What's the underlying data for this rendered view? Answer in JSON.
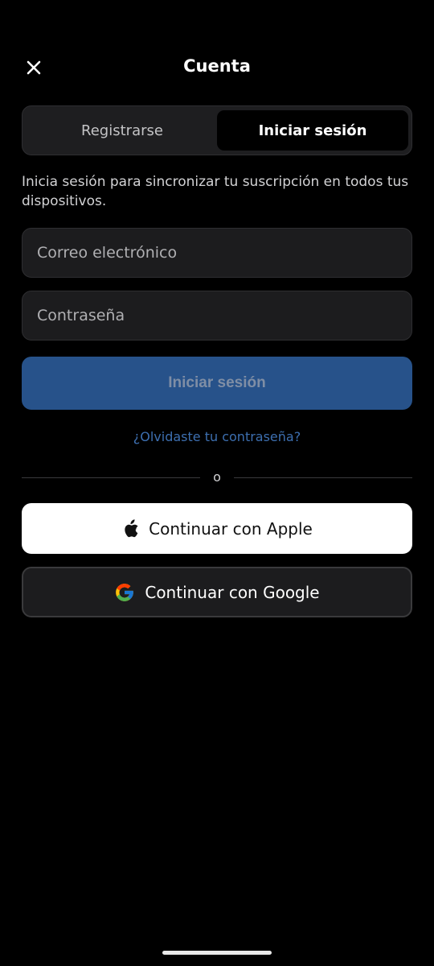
{
  "header": {
    "title": "Cuenta",
    "close_icon": "close-icon"
  },
  "segment": {
    "register_label": "Registrarse",
    "login_label": "Iniciar sesión",
    "selected": "login"
  },
  "intro": {
    "text": "Inicia sesión para sincronizar tu suscripción en todos tus dispositivos."
  },
  "form": {
    "email_placeholder": "Correo electrónico",
    "email_value": "",
    "password_placeholder": "Contraseña",
    "password_value": "",
    "submit_label": "Iniciar sesión",
    "forgot_label": "¿Olvidaste tu contraseña?"
  },
  "divider": {
    "label": "o"
  },
  "social": {
    "apple_label": "Continuar con Apple",
    "apple_icon": "apple-icon",
    "google_label": "Continuar con Google",
    "google_icon": "google-icon"
  },
  "colors": {
    "background": "#000000",
    "primary_button": "#27528a",
    "link": "#3d6fb0"
  }
}
